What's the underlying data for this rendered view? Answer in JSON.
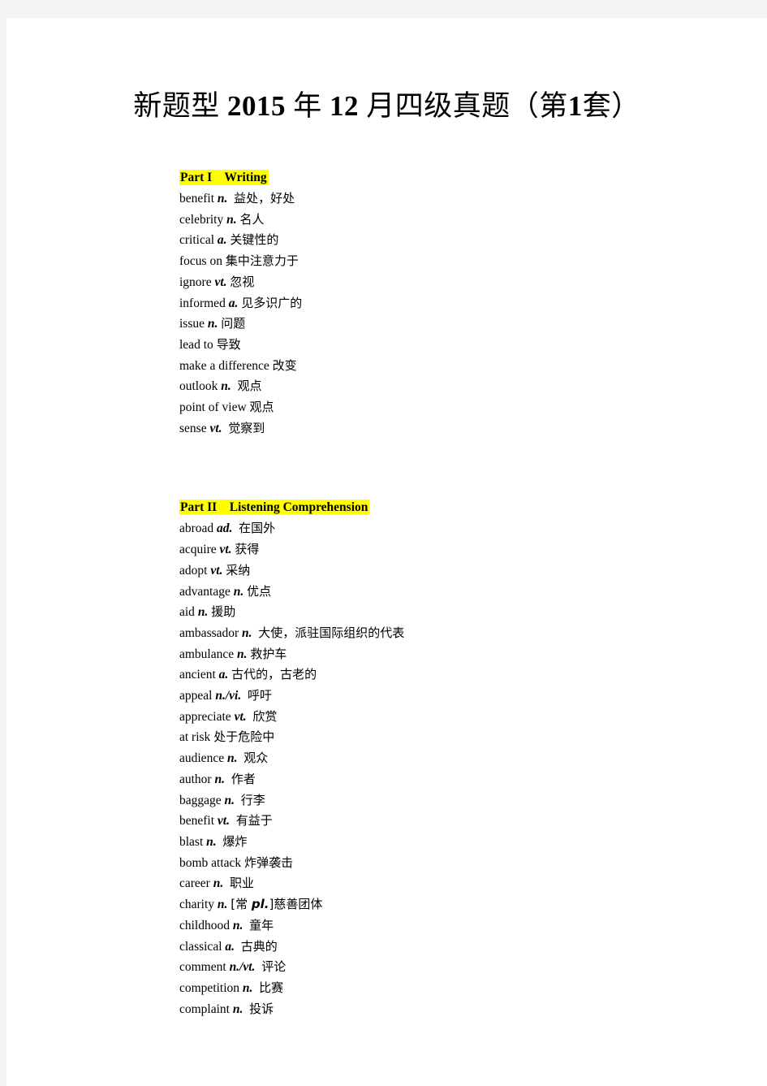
{
  "document": {
    "title_prefix_cn": "新题型",
    "title_latin_1": "2015",
    "title_cn_year": "年",
    "title_latin_2": "12",
    "title_cn_month_rest": "月四级真题（第",
    "title_latin_3": "1",
    "title_cn_suffix": "套）",
    "title_full": "新题型 2015 年 12 月四级真题（第 1 套）"
  },
  "sections": [
    {
      "heading": "Part I    Writing",
      "entries": [
        {
          "word": "benefit ",
          "pos": "n.",
          "sep": "  ",
          "meaning": "益处，好处"
        },
        {
          "word": "celebrity ",
          "pos": "n.",
          "sep": " ",
          "meaning": "名人"
        },
        {
          "word": "critical ",
          "pos": "a.",
          "sep": " ",
          "meaning": "关键性的"
        },
        {
          "word": "focus on ",
          "pos": "",
          "sep": "",
          "meaning": "集中注意力于"
        },
        {
          "word": "ignore ",
          "pos": "vt.",
          "sep": " ",
          "meaning": "忽视"
        },
        {
          "word": "informed ",
          "pos": "a.",
          "sep": " ",
          "meaning": "见多识广的"
        },
        {
          "word": "issue ",
          "pos": "n.",
          "sep": " ",
          "meaning": "问题"
        },
        {
          "word": "lead to ",
          "pos": "",
          "sep": "",
          "meaning": "导致"
        },
        {
          "word": "make a difference ",
          "pos": "",
          "sep": "",
          "meaning": "改变"
        },
        {
          "word": "outlook ",
          "pos": "n.",
          "sep": "  ",
          "meaning": "观点"
        },
        {
          "word": "point of view ",
          "pos": "",
          "sep": "",
          "meaning": "观点"
        },
        {
          "word": "sense ",
          "pos": "vt.",
          "sep": "  ",
          "meaning": "觉察到"
        }
      ]
    },
    {
      "heading": "Part II    Listening Comprehension",
      "entries": [
        {
          "word": "abroad ",
          "pos": "ad.",
          "sep": "  ",
          "meaning": "在国外"
        },
        {
          "word": "acquire ",
          "pos": "vt.",
          "sep": " ",
          "meaning": "获得"
        },
        {
          "word": "adopt ",
          "pos": "vt.",
          "sep": " ",
          "meaning": "采纳"
        },
        {
          "word": "advantage ",
          "pos": "n.",
          "sep": " ",
          "meaning": "优点"
        },
        {
          "word": "aid ",
          "pos": "n.",
          "sep": " ",
          "meaning": "援助"
        },
        {
          "word": "ambassador ",
          "pos": "n.",
          "sep": "  ",
          "meaning": "大使，派驻国际组织的代表"
        },
        {
          "word": "ambulance ",
          "pos": "n.",
          "sep": " ",
          "meaning": "救护车"
        },
        {
          "word": "ancient ",
          "pos": "a.",
          "sep": " ",
          "meaning": "古代的，古老的"
        },
        {
          "word": "appeal ",
          "pos": "n./vi.",
          "sep": "  ",
          "meaning": "呼吁"
        },
        {
          "word": "appreciate ",
          "pos": "vt.",
          "sep": "  ",
          "meaning": "欣赏"
        },
        {
          "word": "at risk ",
          "pos": "",
          "sep": "",
          "meaning": "处于危险中"
        },
        {
          "word": "audience ",
          "pos": "n.",
          "sep": "  ",
          "meaning": "观众"
        },
        {
          "word": "author ",
          "pos": "n.",
          "sep": "  ",
          "meaning": "作者"
        },
        {
          "word": "baggage ",
          "pos": "n.",
          "sep": "  ",
          "meaning": "行李"
        },
        {
          "word": "benefit ",
          "pos": "vt.",
          "sep": "  ",
          "meaning": "有益于"
        },
        {
          "word": "blast ",
          "pos": "n.",
          "sep": "  ",
          "meaning": "爆炸"
        },
        {
          "word": "bomb attack ",
          "pos": "",
          "sep": "",
          "meaning": "炸弹袭击"
        },
        {
          "word": "career ",
          "pos": "n.",
          "sep": "  ",
          "meaning": "职业"
        },
        {
          "word": "charity ",
          "pos": "n.",
          "sep": " ",
          "meaning": "[常 pl.]慈善团体",
          "meaning_pre": "[常 ",
          "meaning_em": "pl.",
          "meaning_post": "]慈善团体"
        },
        {
          "word": "childhood ",
          "pos": "n.",
          "sep": "  ",
          "meaning": "童年"
        },
        {
          "word": "classical ",
          "pos": "a.",
          "sep": "  ",
          "meaning": "古典的"
        },
        {
          "word": "comment ",
          "pos": "n./vt.",
          "sep": "  ",
          "meaning": "评论"
        },
        {
          "word": "competition ",
          "pos": "n.",
          "sep": "  ",
          "meaning": "比赛"
        },
        {
          "word": "complaint ",
          "pos": "n.",
          "sep": "  ",
          "meaning": "投诉"
        }
      ]
    }
  ],
  "style": {
    "highlight_color": "#ffff00",
    "text_color": "#000000",
    "page_background": "#ffffff",
    "canvas_background": "#f4f4f4"
  }
}
